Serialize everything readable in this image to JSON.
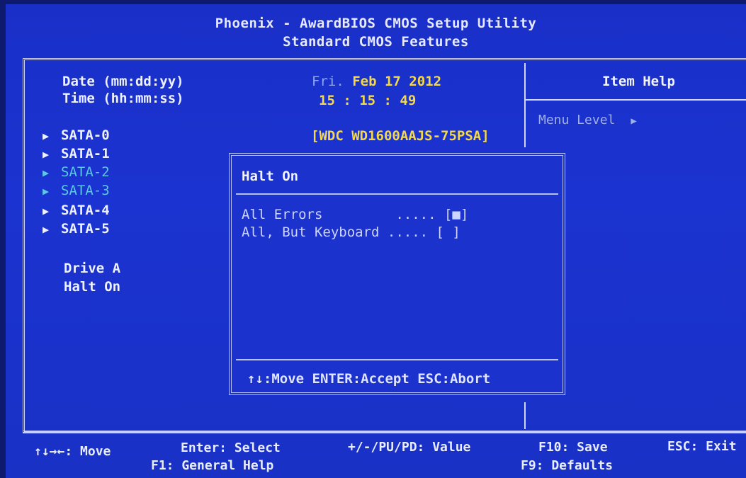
{
  "header": {
    "line1": "Phoenix - AwardBIOS CMOS Setup Utility",
    "line2": "Standard CMOS Features"
  },
  "fields": {
    "date_label": "Date (mm:dd:yy)",
    "time_label": "Time (hh:mm:ss)",
    "date_day": "Fri.",
    "date_value": "Feb 17 2012",
    "time_value": "15 : 15 : 49",
    "sata0_value": "[WDC WD1600AAJS-75PSA]"
  },
  "items": [
    {
      "label": "SATA-0",
      "dim": false
    },
    {
      "label": "SATA-1",
      "dim": false
    },
    {
      "label": "SATA-2",
      "dim": true
    },
    {
      "label": "SATA-3",
      "dim": true
    },
    {
      "label": "SATA-4",
      "dim": false
    },
    {
      "label": "SATA-5",
      "dim": false
    }
  ],
  "extra_items": [
    "Drive A",
    "Halt On"
  ],
  "help_panel": {
    "title": "Item Help",
    "menu_level": "Menu Level",
    "arrow_icon": "right-triangle-icon"
  },
  "dialog": {
    "title": "Halt On",
    "options": [
      {
        "label": "All Errors         ..... [■]",
        "selected": true
      },
      {
        "label": "All, But Keyboard ..... [ ]",
        "selected": false
      }
    ],
    "footer": "↑↓:Move ENTER:Accept ESC:Abort"
  },
  "bottom_bar": {
    "move": "↑↓→←: Move",
    "enter": "Enter: Select",
    "value": "+/-/PU/PD: Value",
    "save": "F10: Save",
    "exit": "ESC: Exit",
    "help": "F1: General Help",
    "defaults": "F9: Defaults"
  },
  "colors": {
    "background": "#1a2fc8",
    "value_yellow": "#f2d84a",
    "dim_cyan": "#5cc8e6"
  }
}
